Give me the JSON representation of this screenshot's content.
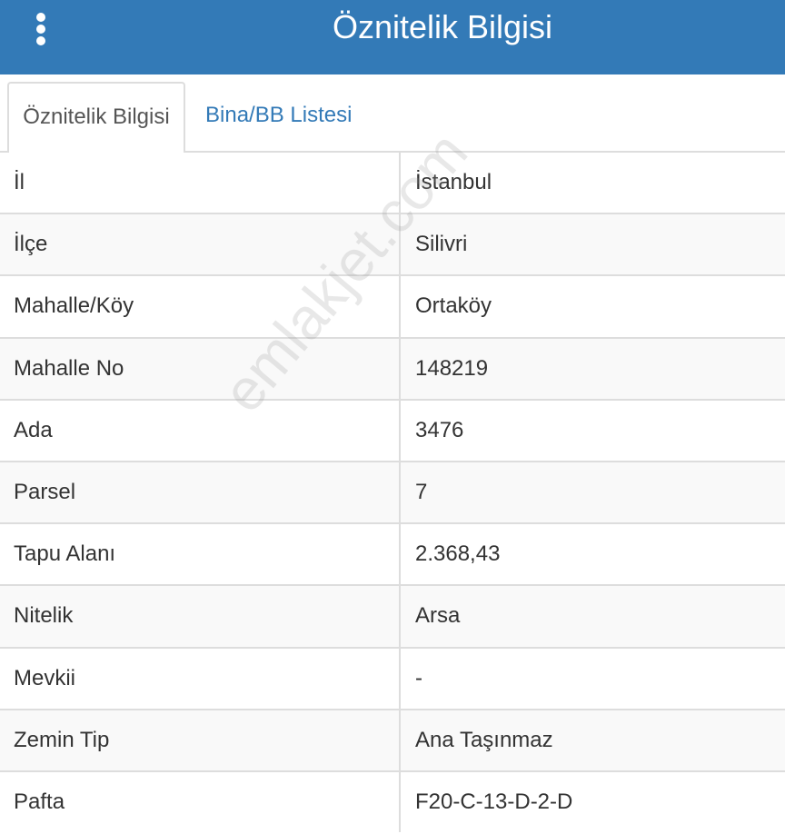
{
  "header": {
    "title": "Öznitelik Bilgisi",
    "menu_icon": "kebab-menu-icon"
  },
  "tabs": [
    {
      "label": "Öznitelik Bilgisi",
      "active": true
    },
    {
      "label": "Bina/BB Listesi",
      "active": false
    }
  ],
  "rows": [
    {
      "label": "İl",
      "value": "İstanbul"
    },
    {
      "label": "İlçe",
      "value": "Silivri"
    },
    {
      "label": "Mahalle/Köy",
      "value": "Ortaköy"
    },
    {
      "label": "Mahalle No",
      "value": "148219"
    },
    {
      "label": "Ada",
      "value": "3476"
    },
    {
      "label": "Parsel",
      "value": "7"
    },
    {
      "label": "Tapu Alanı",
      "value": "2.368,43"
    },
    {
      "label": "Nitelik",
      "value": "Arsa"
    },
    {
      "label": "Mevkii",
      "value": "-"
    },
    {
      "label": "Zemin Tip",
      "value": "Ana Taşınmaz"
    },
    {
      "label": "Pafta",
      "value": "F20-C-13-D-2-D"
    }
  ],
  "watermark": "emlakjet.com",
  "colors": {
    "header_bg": "#337ab7",
    "tab_link": "#337ab7",
    "border": "#dddddd",
    "row_alt": "#f9f9f9"
  }
}
